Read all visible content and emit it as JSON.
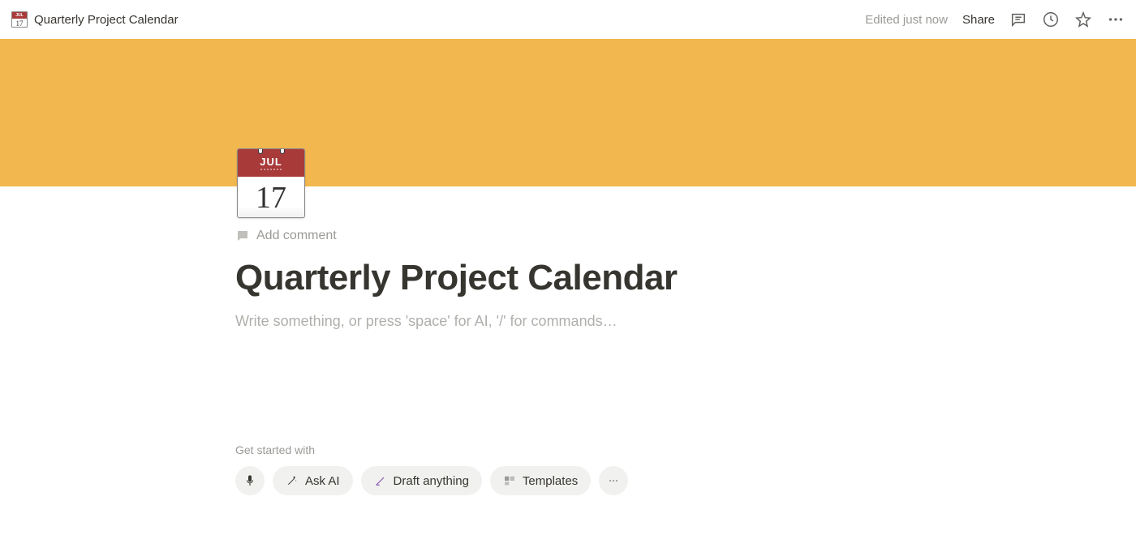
{
  "topbar": {
    "breadcrumb_title": "Quarterly Project Calendar",
    "edited": "Edited just now",
    "share": "Share"
  },
  "page": {
    "icon_month": "JUL",
    "icon_day": "17",
    "add_comment": "Add comment",
    "title": "Quarterly Project Calendar",
    "body_placeholder": "Write something, or press 'space' for AI, '/' for commands…"
  },
  "get_started": {
    "label": "Get started with",
    "ask_ai": "Ask AI",
    "draft_anything": "Draft anything",
    "templates": "Templates"
  },
  "colors": {
    "cover": "#f2b74e"
  }
}
